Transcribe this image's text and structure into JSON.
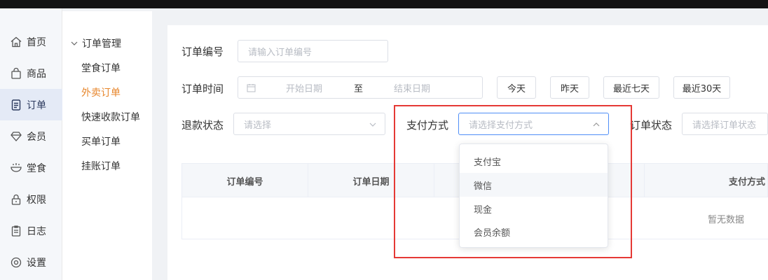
{
  "sidebar": {
    "items": [
      {
        "label": "首页",
        "icon": "home-icon"
      },
      {
        "label": "商品",
        "icon": "bag-icon"
      },
      {
        "label": "订单",
        "icon": "document-icon",
        "active": true
      },
      {
        "label": "会员",
        "icon": "diamond-icon"
      },
      {
        "label": "堂食",
        "icon": "bowl-icon"
      },
      {
        "label": "权限",
        "icon": "lock-icon"
      },
      {
        "label": "日志",
        "icon": "clipboard-icon"
      },
      {
        "label": "设置",
        "icon": "gear-icon"
      }
    ]
  },
  "subnav": {
    "title": "订单管理",
    "items": [
      {
        "label": "堂食订单"
      },
      {
        "label": "外卖订单",
        "active": true
      },
      {
        "label": "快速收款订单"
      },
      {
        "label": "买单订单"
      },
      {
        "label": "挂账订单"
      }
    ]
  },
  "filters": {
    "order_no_label": "订单编号",
    "order_no_placeholder": "请输入订单编号",
    "order_time_label": "订单时间",
    "start_date_placeholder": "开始日期",
    "date_separator": "至",
    "end_date_placeholder": "结束日期",
    "quick_dates": [
      "今天",
      "昨天",
      "最近七天",
      "最近30天"
    ],
    "refund_label": "退款状态",
    "refund_placeholder": "请选择",
    "payment_label": "支付方式",
    "payment_placeholder": "请选择支付方式",
    "order_status_label": "订单状态",
    "order_status_placeholder": "请选择订单状态"
  },
  "payment_dropdown": {
    "options": [
      "支付宝",
      "微信",
      "现金",
      "会员余额"
    ],
    "hovered_index": 1
  },
  "table": {
    "columns": [
      "订单编号",
      "订单日期",
      "",
      "支付方式"
    ],
    "empty_text": "暂无数据"
  },
  "colors": {
    "accent": "#e7862c",
    "highlight": "#e53935",
    "focus": "#4f8ef7"
  }
}
